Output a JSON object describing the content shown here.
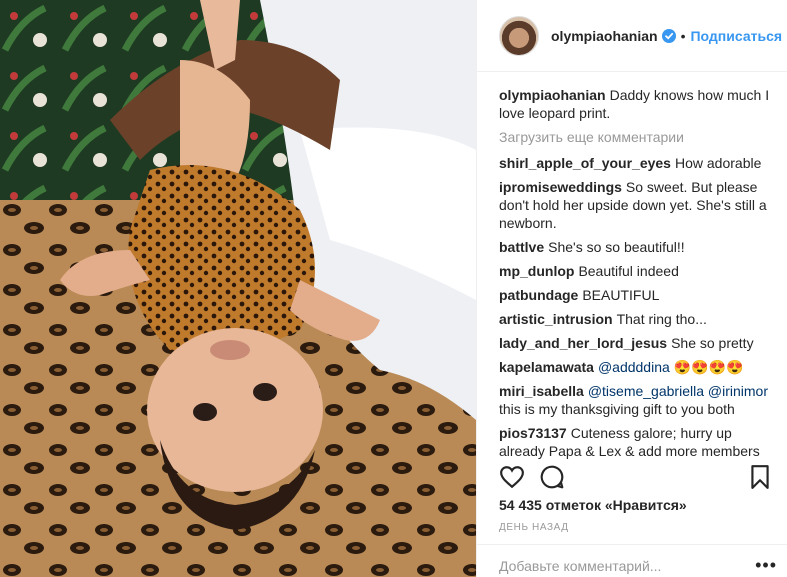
{
  "post": {
    "author": "olympiaohanian",
    "follow_label": "Подписаться",
    "dot": "•",
    "caption": {
      "user": "olympiaohanian",
      "text": "Daddy knows how much I love leopard print."
    },
    "load_more": "Загрузить еще комментарии",
    "comments": [
      {
        "user": "shirl_apple_of_your_eyes",
        "text": "How adorable"
      },
      {
        "user": "ipromiseweddings",
        "text": "So sweet. But please don't hold her upside down yet. She's still a newborn."
      },
      {
        "user": "battlve",
        "text": "She's so so beautiful!!"
      },
      {
        "user": "mp_dunlop",
        "text": "Beautiful indeed"
      },
      {
        "user": "patbundage",
        "text": "BEAUTIFUL"
      },
      {
        "user": "artistic_intrusion",
        "text": "That ring tho..."
      },
      {
        "user": "lady_and_her_lord_jesus",
        "text": "She so pretty"
      },
      {
        "user": "kapelamawata",
        "mentions": "@addddina",
        "text": "😍😍😍😍"
      },
      {
        "user": "miri_isabella",
        "mentions": "@tiseme_gabriella @irinimor",
        "text": "this is my thanksgiving gift to you both"
      },
      {
        "user": "pios73137",
        "text": "Cuteness galore; hurry up already Papa & Lex & add more members"
      }
    ],
    "likes": "54 435 отметок «Нравится»",
    "time": "ДЕНЬ НАЗАД",
    "add_comment_placeholder": "Добавьте комментарий...",
    "more_label": "•••"
  },
  "colors": {
    "link": "#3897f0",
    "verified": "#3897f0",
    "muted": "#999999"
  }
}
